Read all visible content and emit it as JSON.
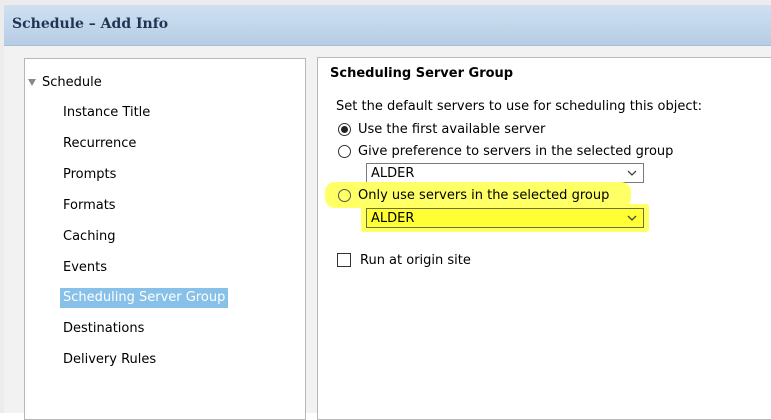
{
  "window": {
    "title": "Schedule – Add Info"
  },
  "tree": {
    "root_label": "Schedule",
    "items": [
      {
        "label": "Instance Title"
      },
      {
        "label": "Recurrence"
      },
      {
        "label": "Prompts"
      },
      {
        "label": "Formats"
      },
      {
        "label": "Caching"
      },
      {
        "label": "Events"
      },
      {
        "label": "Scheduling Server Group",
        "selected": true
      },
      {
        "label": "Destinations"
      },
      {
        "label": "Delivery Rules"
      }
    ]
  },
  "panel": {
    "title": "Scheduling Server Group",
    "description": "Set the default servers to use for scheduling this object:",
    "options": {
      "first_available": {
        "label": "Use the first available server",
        "checked": true
      },
      "give_preference": {
        "label": "Give preference to servers in the selected group",
        "checked": false,
        "group_value": "ALDER"
      },
      "only_use": {
        "label": "Only use servers in the selected group",
        "checked": false,
        "group_value": "ALDER"
      }
    },
    "run_at_origin": {
      "label": "Run at origin site",
      "checked": false
    }
  },
  "colors": {
    "highlight": "#ffff66",
    "selected_item": "#87c0e8",
    "title_bar": "#c3d6ea"
  },
  "icons": {
    "tree_expand": "triangle-down-icon",
    "dropdown": "chevron-down-icon"
  }
}
